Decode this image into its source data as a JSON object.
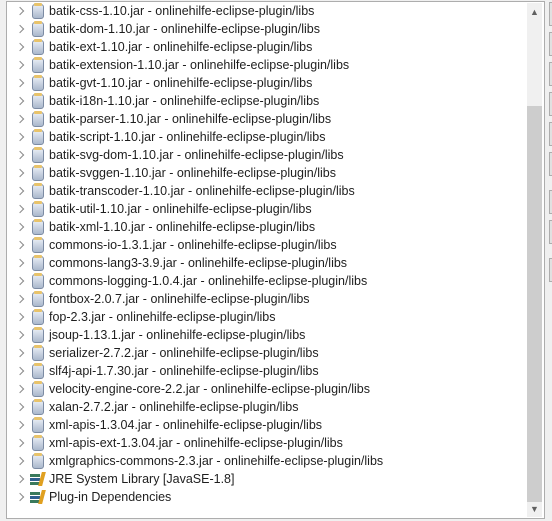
{
  "tree": {
    "items": [
      {
        "label": "batik-css-1.10.jar - onlinehilfe-eclipse-plugin/libs",
        "icon": "jar-icon"
      },
      {
        "label": "batik-dom-1.10.jar - onlinehilfe-eclipse-plugin/libs",
        "icon": "jar-icon"
      },
      {
        "label": "batik-ext-1.10.jar - onlinehilfe-eclipse-plugin/libs",
        "icon": "jar-icon"
      },
      {
        "label": "batik-extension-1.10.jar - onlinehilfe-eclipse-plugin/libs",
        "icon": "jar-icon"
      },
      {
        "label": "batik-gvt-1.10.jar - onlinehilfe-eclipse-plugin/libs",
        "icon": "jar-icon"
      },
      {
        "label": "batik-i18n-1.10.jar - onlinehilfe-eclipse-plugin/libs",
        "icon": "jar-icon"
      },
      {
        "label": "batik-parser-1.10.jar - onlinehilfe-eclipse-plugin/libs",
        "icon": "jar-icon"
      },
      {
        "label": "batik-script-1.10.jar - onlinehilfe-eclipse-plugin/libs",
        "icon": "jar-icon"
      },
      {
        "label": "batik-svg-dom-1.10.jar - onlinehilfe-eclipse-plugin/libs",
        "icon": "jar-icon"
      },
      {
        "label": "batik-svggen-1.10.jar - onlinehilfe-eclipse-plugin/libs",
        "icon": "jar-icon"
      },
      {
        "label": "batik-transcoder-1.10.jar - onlinehilfe-eclipse-plugin/libs",
        "icon": "jar-icon"
      },
      {
        "label": "batik-util-1.10.jar - onlinehilfe-eclipse-plugin/libs",
        "icon": "jar-icon"
      },
      {
        "label": "batik-xml-1.10.jar - onlinehilfe-eclipse-plugin/libs",
        "icon": "jar-icon"
      },
      {
        "label": "commons-io-1.3.1.jar - onlinehilfe-eclipse-plugin/libs",
        "icon": "jar-icon"
      },
      {
        "label": "commons-lang3-3.9.jar - onlinehilfe-eclipse-plugin/libs",
        "icon": "jar-icon"
      },
      {
        "label": "commons-logging-1.0.4.jar - onlinehilfe-eclipse-plugin/libs",
        "icon": "jar-icon"
      },
      {
        "label": "fontbox-2.0.7.jar - onlinehilfe-eclipse-plugin/libs",
        "icon": "jar-icon"
      },
      {
        "label": "fop-2.3.jar - onlinehilfe-eclipse-plugin/libs",
        "icon": "jar-icon"
      },
      {
        "label": "jsoup-1.13.1.jar - onlinehilfe-eclipse-plugin/libs",
        "icon": "jar-icon"
      },
      {
        "label": "serializer-2.7.2.jar - onlinehilfe-eclipse-plugin/libs",
        "icon": "jar-icon"
      },
      {
        "label": "slf4j-api-1.7.30.jar - onlinehilfe-eclipse-plugin/libs",
        "icon": "jar-icon"
      },
      {
        "label": "velocity-engine-core-2.2.jar - onlinehilfe-eclipse-plugin/libs",
        "icon": "jar-icon"
      },
      {
        "label": "xalan-2.7.2.jar - onlinehilfe-eclipse-plugin/libs",
        "icon": "jar-icon"
      },
      {
        "label": "xml-apis-1.3.04.jar - onlinehilfe-eclipse-plugin/libs",
        "icon": "jar-icon"
      },
      {
        "label": "xml-apis-ext-1.3.04.jar - onlinehilfe-eclipse-plugin/libs",
        "icon": "jar-icon"
      },
      {
        "label": "xmlgraphics-commons-2.3.jar - onlinehilfe-eclipse-plugin/libs",
        "icon": "jar-icon"
      },
      {
        "label": "JRE System Library [JavaSE-1.8]",
        "icon": "library-icon"
      },
      {
        "label": "Plug-in Dependencies",
        "icon": "library-icon"
      }
    ]
  },
  "scrollbar": {
    "position_fraction": 0.2,
    "visible_fraction": 0.8
  }
}
